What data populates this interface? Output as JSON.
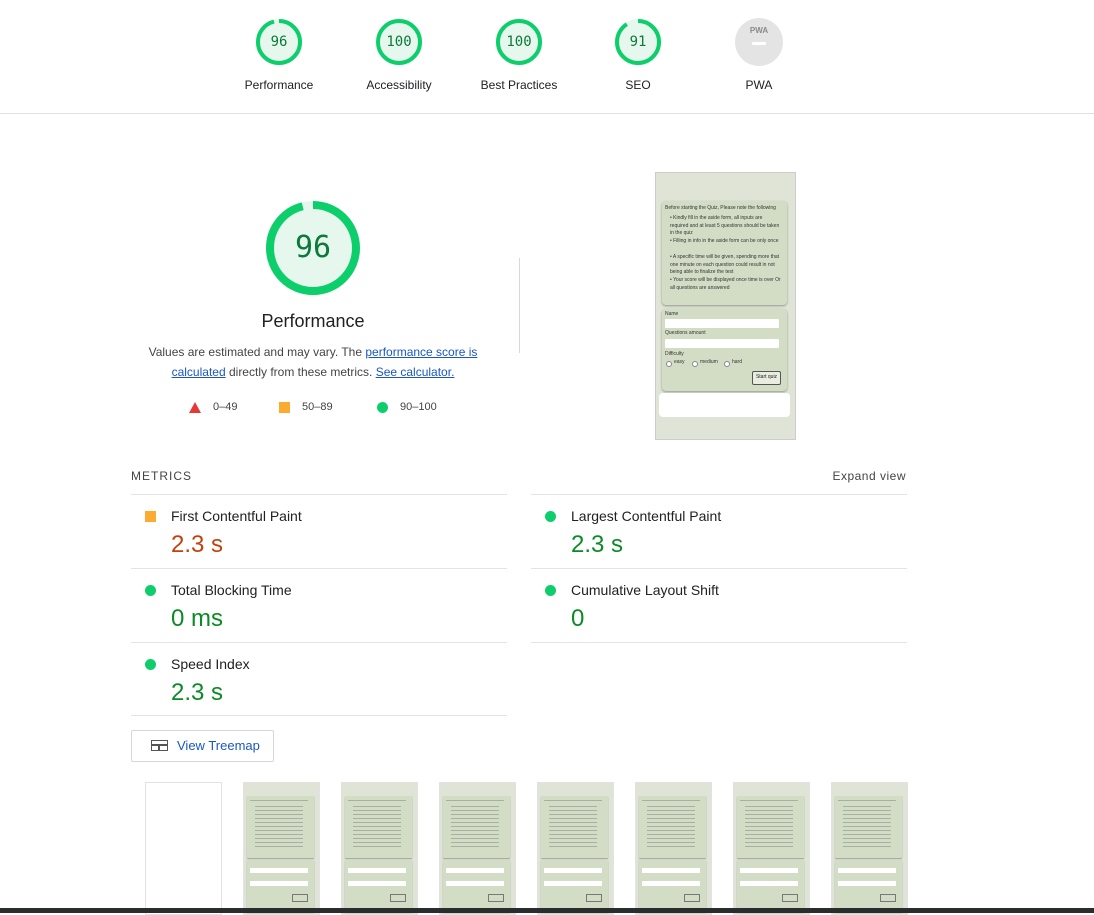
{
  "scores": [
    {
      "label": "Performance",
      "score": "96",
      "value": 96
    },
    {
      "label": "Accessibility",
      "score": "100",
      "value": 100
    },
    {
      "label": "Best Practices",
      "score": "100",
      "value": 100
    },
    {
      "label": "SEO",
      "score": "91",
      "value": 91
    },
    {
      "label": "PWA",
      "badge_text": "PWA"
    }
  ],
  "performance": {
    "score": "96",
    "value": 96,
    "title": "Performance",
    "desc_prefix": "Values are estimated and may vary. The ",
    "link1": "performance score is calculated",
    "desc_middle": " directly from these metrics. ",
    "link2": "See calculator."
  },
  "legend": [
    {
      "range": "0–49",
      "color": "#e53935"
    },
    {
      "range": "50–89",
      "color": "#fbab2f"
    },
    {
      "range": "90–100",
      "color": "#0cce6b"
    }
  ],
  "screenshot": {
    "intro": "Before starting the Quiz, Please note the following",
    "bullets": [
      "Kindly fill in the aside form, all inputs are required and at least 5 questions should be taken in the quiz",
      "Filling in info in the aside form can be only once",
      "A specific time will be given, spending more that one minute on each question could result in not being able to finalize the test",
      "Your score will be displayed once time is over Or all questions are answered"
    ],
    "name_label": "Name",
    "questions_label": "Questions amount",
    "difficulty_label": "Difficulty",
    "options": [
      "easy",
      "medium",
      "hard"
    ],
    "button": "Start quiz"
  },
  "metrics": {
    "header": "METRICS",
    "expand": "Expand view",
    "items": [
      {
        "name": "First Contentful Paint",
        "value": "2.3 s",
        "status": "average"
      },
      {
        "name": "Largest Contentful Paint",
        "value": "2.3 s",
        "status": "pass"
      },
      {
        "name": "Total Blocking Time",
        "value": "0 ms",
        "status": "pass"
      },
      {
        "name": "Cumulative Layout Shift",
        "value": "0",
        "status": "pass"
      },
      {
        "name": "Speed Index",
        "value": "2.3 s",
        "status": "pass"
      }
    ]
  },
  "treemap_label": "View Treemap",
  "colors": {
    "pass": "#0cce6b",
    "average": "#fbab2f",
    "fail": "#e53935",
    "pass_text": "#0b8a26",
    "average_text": "#c2410c",
    "link": "#1a57c4"
  }
}
